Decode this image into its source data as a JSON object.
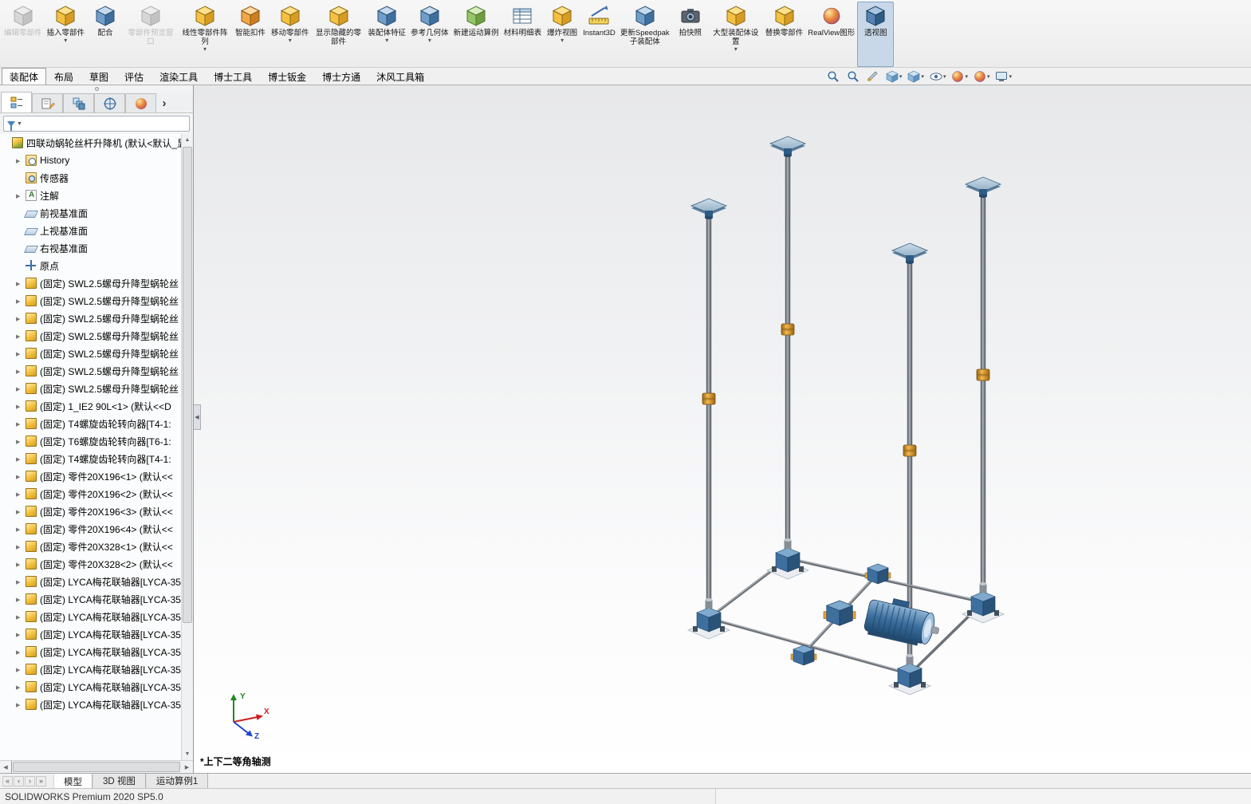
{
  "window": {
    "status_left": "SOLIDWORKS Premium 2020 SP5.0"
  },
  "colors": {
    "accent_blue": "#3e6f9f",
    "active_button_highlight": "#c8d8e8",
    "collar_orange": "#eead43",
    "part_icon_yellow": "#f2bf3a"
  },
  "ribbon": {
    "items": [
      {
        "label": "编辑零部件",
        "icon": "edit-component",
        "disabled": true
      },
      {
        "label": "插入零部件",
        "icon": "insert-component",
        "dropdown": true
      },
      {
        "label": "配合",
        "icon": "mate"
      },
      {
        "label": "零部件预览窗口",
        "icon": "component-preview",
        "disabled": true
      },
      {
        "label": "线性零部件阵列",
        "icon": "linear-component-pattern",
        "dropdown": true
      },
      {
        "label": "智能扣件",
        "icon": "smart-fasteners"
      },
      {
        "label": "移动零部件",
        "icon": "move-component",
        "dropdown": true
      },
      {
        "label": "显示隐藏的零部件",
        "icon": "show-hidden-components"
      },
      {
        "label": "装配体特征",
        "icon": "assembly-features",
        "dropdown": true
      },
      {
        "label": "参考几何体",
        "icon": "reference-geometry",
        "dropdown": true
      },
      {
        "label": "新建运动算例",
        "icon": "new-motion-study"
      },
      {
        "label": "材料明细表",
        "icon": "bom-table"
      },
      {
        "label": "爆炸视图",
        "icon": "exploded-view",
        "dropdown": true
      },
      {
        "label": "Instant3D",
        "icon": "instant3d"
      },
      {
        "label": "更新Speedpak子装配体",
        "icon": "update-speedpak"
      },
      {
        "label": "拍快照",
        "icon": "take-snapshot"
      },
      {
        "label": "大型装配体设置",
        "icon": "large-assembly-settings",
        "dropdown": true
      },
      {
        "label": "替换零部件",
        "icon": "replace-components"
      },
      {
        "label": "RealView图形",
        "icon": "realview"
      },
      {
        "label": "透视图",
        "icon": "perspective",
        "active": true
      }
    ]
  },
  "command_tabs": {
    "items": [
      {
        "label": "装配体",
        "active": true
      },
      {
        "label": "布局"
      },
      {
        "label": "草图"
      },
      {
        "label": "评估"
      },
      {
        "label": "渲染工具"
      },
      {
        "label": "博士工具"
      },
      {
        "label": "博士钣金"
      },
      {
        "label": "博士方通"
      },
      {
        "label": "沐风工具箱"
      }
    ]
  },
  "view_toolbar": {
    "items": [
      {
        "icon": "zoom-fit-icon",
        "glyph": "mag"
      },
      {
        "icon": "zoom-area-icon",
        "glyph": "mag"
      },
      {
        "icon": "section-view-icon",
        "glyph": "knife"
      },
      {
        "icon": "view-orientation-icon",
        "glyph": "cube",
        "dropdown": true
      },
      {
        "icon": "display-style-icon",
        "glyph": "cube",
        "dropdown": true
      },
      {
        "icon": "hide-show-items-icon",
        "glyph": "eye",
        "dropdown": true
      },
      {
        "icon": "edit-appearance-icon",
        "glyph": "ball",
        "dropdown": true
      },
      {
        "icon": "apply-scene-icon",
        "glyph": "ball",
        "dropdown": true
      },
      {
        "icon": "view-settings-icon",
        "glyph": "monitor",
        "dropdown": true
      }
    ]
  },
  "panel_tabs": {
    "items": [
      {
        "icon": "featuremanager-tree-tab",
        "glyph": "tree",
        "active": true
      },
      {
        "icon": "propertymanager-tab",
        "glyph": "prop"
      },
      {
        "icon": "configurationmanager-tab",
        "glyph": "config"
      },
      {
        "icon": "dimxpertmanager-tab",
        "glyph": "dimx"
      },
      {
        "icon": "displaymanager-tab",
        "glyph": "display"
      },
      {
        "icon": "panel-expand-arrow",
        "glyph": "chev"
      }
    ]
  },
  "tree": {
    "items": [
      {
        "icon": "assembly",
        "label": "四联动蜗轮丝杆升降机 (默认<默认_显",
        "level": 0
      },
      {
        "icon": "history",
        "label": "History",
        "arrow": true,
        "level": 1
      },
      {
        "icon": "sensors",
        "label": "传感器",
        "level": 1
      },
      {
        "icon": "annotations",
        "label": "注解",
        "arrow": true,
        "level": 1
      },
      {
        "icon": "plane",
        "label": "前视基准面",
        "level": 1
      },
      {
        "icon": "plane",
        "label": "上视基准面",
        "level": 1
      },
      {
        "icon": "plane",
        "label": "右视基准面",
        "level": 1
      },
      {
        "icon": "origin",
        "label": "原点",
        "level": 1
      },
      {
        "icon": "part",
        "label": "(固定) SWL2.5螺母升降型蜗轮丝",
        "arrow": true,
        "level": 1
      },
      {
        "icon": "part",
        "label": "(固定) SWL2.5螺母升降型蜗轮丝",
        "arrow": true,
        "level": 1
      },
      {
        "icon": "part",
        "label": "(固定) SWL2.5螺母升降型蜗轮丝",
        "arrow": true,
        "level": 1
      },
      {
        "icon": "part",
        "label": "(固定) SWL2.5螺母升降型蜗轮丝",
        "arrow": true,
        "level": 1
      },
      {
        "icon": "part",
        "label": "(固定) SWL2.5螺母升降型蜗轮丝",
        "arrow": true,
        "level": 1
      },
      {
        "icon": "part",
        "label": "(固定) SWL2.5螺母升降型蜗轮丝",
        "arrow": true,
        "level": 1
      },
      {
        "icon": "part",
        "label": "(固定) SWL2.5螺母升降型蜗轮丝",
        "arrow": true,
        "level": 1
      },
      {
        "icon": "part",
        "label": "(固定) 1_IE2 90L<1> (默认<<D",
        "arrow": true,
        "level": 1
      },
      {
        "icon": "part",
        "label": "(固定) T4螺旋齿轮转向器[T4-1:",
        "arrow": true,
        "level": 1
      },
      {
        "icon": "part",
        "label": "(固定) T6螺旋齿轮转向器[T6-1:",
        "arrow": true,
        "level": 1
      },
      {
        "icon": "part",
        "label": "(固定) T4螺旋齿轮转向器[T4-1:",
        "arrow": true,
        "level": 1
      },
      {
        "icon": "part",
        "label": "(固定) 零件20X196<1> (默认<<",
        "arrow": true,
        "level": 1
      },
      {
        "icon": "part",
        "label": "(固定) 零件20X196<2> (默认<<",
        "arrow": true,
        "level": 1
      },
      {
        "icon": "part",
        "label": "(固定) 零件20X196<3> (默认<<",
        "arrow": true,
        "level": 1
      },
      {
        "icon": "part",
        "label": "(固定) 零件20X196<4> (默认<<",
        "arrow": true,
        "level": 1
      },
      {
        "icon": "part",
        "label": "(固定) 零件20X328<1> (默认<<",
        "arrow": true,
        "level": 1
      },
      {
        "icon": "part",
        "label": "(固定) 零件20X328<2> (默认<<",
        "arrow": true,
        "level": 1
      },
      {
        "icon": "part",
        "label": "(固定) LYCA梅花联轴器[LYCA-35",
        "arrow": true,
        "level": 1
      },
      {
        "icon": "part",
        "label": "(固定) LYCA梅花联轴器[LYCA-35",
        "arrow": true,
        "level": 1
      },
      {
        "icon": "part",
        "label": "(固定) LYCA梅花联轴器[LYCA-35",
        "arrow": true,
        "level": 1
      },
      {
        "icon": "part",
        "label": "(固定) LYCA梅花联轴器[LYCA-35",
        "arrow": true,
        "level": 1
      },
      {
        "icon": "part",
        "label": "(固定) LYCA梅花联轴器[LYCA-35",
        "arrow": true,
        "level": 1
      },
      {
        "icon": "part",
        "label": "(固定) LYCA梅花联轴器[LYCA-35",
        "arrow": true,
        "level": 1
      },
      {
        "icon": "part",
        "label": "(固定) LYCA梅花联轴器[LYCA-35",
        "arrow": true,
        "level": 1
      },
      {
        "icon": "part",
        "label": "(固定) LYCA梅花联轴器[LYCA-35",
        "arrow": true,
        "level": 1
      }
    ]
  },
  "viewport": {
    "view_label": "*上下二等角轴测",
    "triad": {
      "x": "X",
      "y": "Y",
      "z": "Z"
    }
  },
  "bottom_nav": {
    "items": [
      {
        "icon": "scroll-tabs-first",
        "glyph": "first"
      },
      {
        "icon": "scroll-tabs-prev",
        "glyph": "prev"
      },
      {
        "icon": "scroll-tabs-next",
        "glyph": "next"
      },
      {
        "icon": "scroll-tabs-last",
        "glyph": "last"
      }
    ]
  },
  "bottom_tabs": {
    "items": [
      {
        "label": "模型",
        "active": true
      },
      {
        "label": "3D 视图"
      },
      {
        "label": "运动算例1"
      }
    ]
  }
}
